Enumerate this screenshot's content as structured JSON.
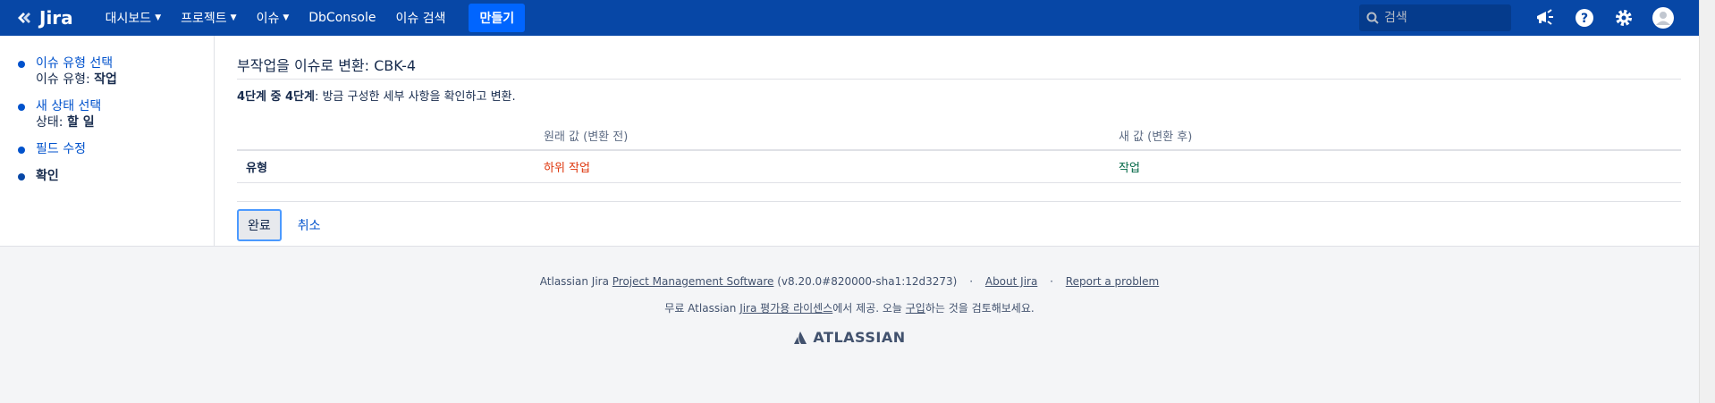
{
  "header": {
    "logo_text": "Jira",
    "nav": [
      {
        "label": "대시보드",
        "dropdown": true
      },
      {
        "label": "프로젝트",
        "dropdown": true
      },
      {
        "label": "이슈",
        "dropdown": true
      },
      {
        "label": "DbConsole",
        "dropdown": false
      },
      {
        "label": "이슈 검색",
        "dropdown": false
      }
    ],
    "create_label": "만들기",
    "search_placeholder": "검색"
  },
  "sidebar": {
    "steps": [
      {
        "title": "이슈 유형 선택",
        "sub_label": "이슈 유형:",
        "sub_value": "작업"
      },
      {
        "title": "새 상태 선택",
        "sub_label": "상태:",
        "sub_value": "할 일"
      },
      {
        "title": "필드 수정"
      },
      {
        "title": "확인"
      }
    ]
  },
  "main": {
    "title": "부작업을 이슈로 변환: CBK-4",
    "step_bold": "4단계 중 4단계",
    "step_text": ": 방금 구성한 세부 사항을 확인하고 변환.",
    "table": {
      "headers": [
        "",
        "원래 값 (변환 전)",
        "새 값 (변환 후)"
      ],
      "rows": [
        {
          "name": "유형",
          "old": "하위 작업",
          "new": "작업"
        }
      ]
    },
    "done_label": "완료",
    "cancel_label": "취소"
  },
  "footer": {
    "line1_prefix": "Atlassian Jira ",
    "line1_link": "Project Management Software",
    "line1_version": " (v8.20.0#820000-sha1:12d3273)",
    "about_link": "About Jira",
    "report_link": "Report a problem",
    "line2_prefix": "무료 Atlassian ",
    "line2_link1": "Jira 평가용 라이센스",
    "line2_mid": "에서 제공. 오늘 ",
    "line2_link2": "구입",
    "line2_suffix": "하는 것을 검토해보세요.",
    "brand": "ATLASSIAN"
  },
  "colors": {
    "header_bg": "#0747a6",
    "create_bg": "#0065ff",
    "link": "#0052cc",
    "old_value": "#de350b",
    "new_value": "#006644"
  }
}
